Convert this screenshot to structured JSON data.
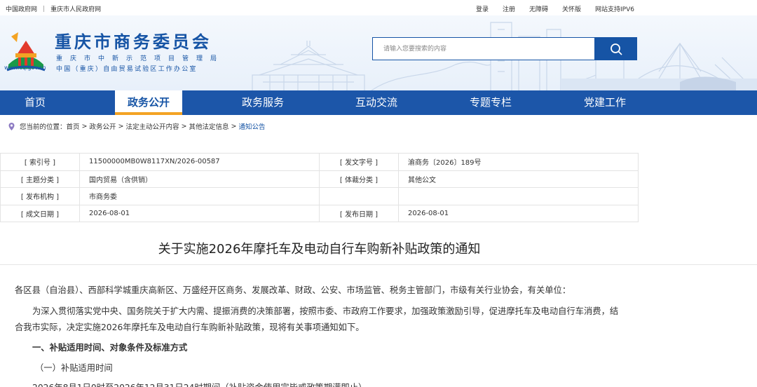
{
  "top_bar": {
    "left_links": [
      "中国政府网",
      "重庆市人民政府网"
    ],
    "right_links": [
      "登录",
      "注册",
      "无障碍",
      "关怀版",
      "网站支持IPV6"
    ]
  },
  "header": {
    "site_title": "重庆市商务委员会",
    "subtitle_1": "重庆市中新示范项目管理局",
    "subtitle_2": "中国（重庆）自由贸易试验区工作办公室",
    "site_url": "www.cq.gov.cn",
    "logo_icon": "chongqing-gov-emblem",
    "search": {
      "placeholder": "请输入您要搜索的内容",
      "button_icon": "search-icon"
    }
  },
  "nav": {
    "items": [
      {
        "label": "首页"
      },
      {
        "label": "政务公开"
      },
      {
        "label": "政务服务"
      },
      {
        "label": "互动交流"
      },
      {
        "label": "专题专栏"
      },
      {
        "label": "党建工作"
      }
    ],
    "active_index": 1
  },
  "breadcrumb": {
    "prefix": "您当前的位置：",
    "items": [
      "首页",
      "政务公开",
      "法定主动公开内容",
      "其他法定信息"
    ],
    "current": "通知公告",
    "separator": ">"
  },
  "meta": {
    "index_no_label": "[ 索引号 ]",
    "index_no": "11500000MB0W8117XN/2026-00587",
    "doc_no_label": "[ 发文字号 ]",
    "doc_no": "渝商务〔2026〕189号",
    "topic_label": "[ 主题分类 ]",
    "topic": "国内贸易（含供销）",
    "genre_label": "[ 体裁分类 ]",
    "genre": "其他公文",
    "issuer_label": "[ 发布机构 ]",
    "issuer": "市商务委",
    "created_label": "[ 成文日期 ]",
    "created": "2026-08-01",
    "published_label": "[ 发布日期 ]",
    "published": "2026-08-01"
  },
  "article": {
    "title": "关于实施2026年摩托车及电动自行车购新补贴政策的通知",
    "salutation": "各区县（自治县）、西部科学城重庆高新区、万盛经开区商务、发展改革、财政、公安、市场监管、税务主管部门，市级有关行业协会，有关单位：",
    "para1_line1": "为深入贯彻落实党中央、国务院关于扩大内需、提振消费的决策部署，按照市委、市政府工作要求，加强政策激励引导，促进摩托车及电动自行车消费，结",
    "para1_line2": "合我市实际，决定实施2026年摩托车及电动自行车购新补贴政策，现将有关事项通知如下。",
    "heading1": "一、补贴适用时间、对象条件及标准方式",
    "subheading1": "（一）补贴适用时间",
    "para2": "2026年8月1日0时至2026年12月31日24时期间（补贴资金使用完毕或政策期满即止）"
  },
  "colors": {
    "brand_blue": "#1654a5",
    "nav_blue": "#1c56a9",
    "active_underline": "#f3a324"
  }
}
